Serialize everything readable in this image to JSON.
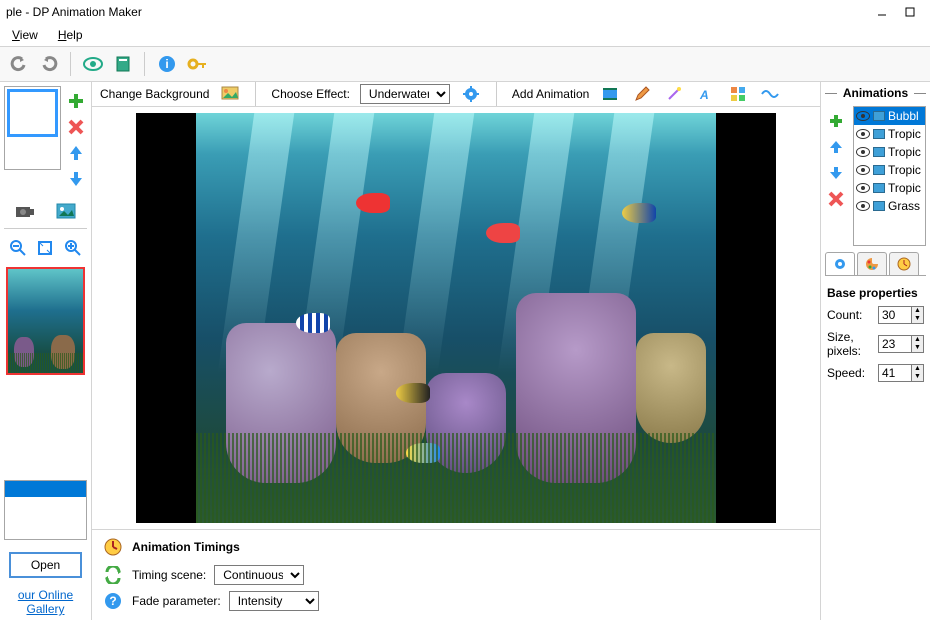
{
  "window": {
    "title": "ple - DP Animation Maker"
  },
  "menu": {
    "view": "View",
    "help": "Help"
  },
  "left": {
    "open": "Open",
    "gallery_link": "our Online Gallery"
  },
  "options": {
    "change_bg": "Change Background",
    "choose_effect": "Choose Effect:",
    "effect_selected": "Underwater",
    "add_animation": "Add Animation"
  },
  "timings": {
    "title": "Animation Timings",
    "scene_label": "Timing scene:",
    "scene_value": "Continuous",
    "fade_label": "Fade parameter:",
    "fade_value": "Intensity"
  },
  "animations": {
    "title": "Animations",
    "items": [
      {
        "label": "Bubbl",
        "selected": true
      },
      {
        "label": "Tropic",
        "selected": false
      },
      {
        "label": "Tropic",
        "selected": false
      },
      {
        "label": "Tropic",
        "selected": false
      },
      {
        "label": "Tropic",
        "selected": false
      },
      {
        "label": "Grass",
        "selected": false
      }
    ]
  },
  "props": {
    "title": "Base properties",
    "count_label": "Count:",
    "count_value": "30",
    "size_label": "Size, pixels:",
    "size_value": "23",
    "speed_label": "Speed:",
    "speed_value": "41"
  }
}
